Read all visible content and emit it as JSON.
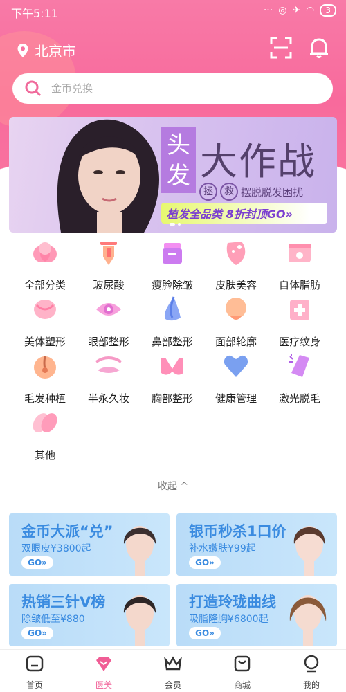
{
  "status_bar": {
    "time": "下午5:11",
    "battery": "3"
  },
  "header": {
    "location": "北京市"
  },
  "search": {
    "placeholder": "金币兑换"
  },
  "banner": {
    "head_text": "头发",
    "big_text": "大作战",
    "circle_1": "拯",
    "circle_2": "救",
    "sub_text": "摆脱脱发困扰",
    "promo": "植发全品类 8折封顶GO»"
  },
  "categories": [
    {
      "label": "全部分类",
      "icon": "all-categories-icon"
    },
    {
      "label": "玻尿酸",
      "icon": "hyaluronic-icon"
    },
    {
      "label": "瘦脸除皱",
      "icon": "slim-face-icon"
    },
    {
      "label": "皮肤美容",
      "icon": "skin-icon"
    },
    {
      "label": "自体脂肪",
      "icon": "fat-icon"
    },
    {
      "label": "美体塑形",
      "icon": "body-shape-icon"
    },
    {
      "label": "眼部整形",
      "icon": "eye-icon"
    },
    {
      "label": "鼻部整形",
      "icon": "nose-icon"
    },
    {
      "label": "面部轮廓",
      "icon": "face-contour-icon"
    },
    {
      "label": "医疗纹身",
      "icon": "medical-tattoo-icon"
    },
    {
      "label": "毛发种植",
      "icon": "hair-icon"
    },
    {
      "label": "半永久妆",
      "icon": "eyebrow-icon"
    },
    {
      "label": "胸部整形",
      "icon": "bra-icon"
    },
    {
      "label": "健康管理",
      "icon": "heart-icon"
    },
    {
      "label": "激光脱毛",
      "icon": "laser-icon"
    },
    {
      "label": "其他",
      "icon": "other-icon"
    }
  ],
  "collapse_label": "收起 ^",
  "cards": [
    {
      "title": "金币大派“兑”",
      "sub": "双眼皮¥3800起",
      "go": "GO»"
    },
    {
      "title": "银币秒杀1口价",
      "sub": "补水嫩肤¥99起",
      "go": "GO»"
    },
    {
      "title": "热销三针V榜",
      "sub": "除皱低至¥880",
      "go": "GO»"
    },
    {
      "title": "打造玲珑曲线",
      "sub": "吸脂隆胸¥6800起",
      "go": "GO»"
    }
  ],
  "tabs": [
    {
      "label": "首页",
      "icon": "home-icon"
    },
    {
      "label": "医美",
      "icon": "gem-icon",
      "active": true
    },
    {
      "label": "会员",
      "icon": "crown-icon"
    },
    {
      "label": "商城",
      "icon": "shop-icon"
    },
    {
      "label": "我的",
      "icon": "profile-icon"
    }
  ],
  "colors": {
    "brand": "#f86a9c",
    "card_text": "#3a8be0",
    "tab_active": "#f05d95"
  }
}
